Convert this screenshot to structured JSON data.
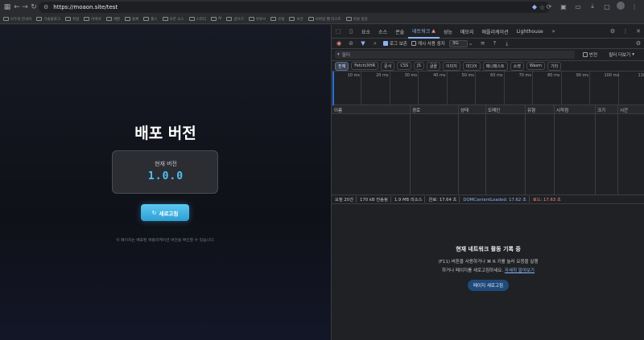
{
  "browser": {
    "url": "https://moaon.site/test",
    "bookmarks": [
      "모두의 한국어",
      "기술블로그",
      "취업",
      "이력서",
      "개발",
      "블록",
      "툴스",
      "오픈 소스",
      "스터디",
      "AI",
      "글쓰기",
      "유튜브",
      "유틸",
      "보안",
      "모바일 웹 리스트",
      "유틸 점검"
    ]
  },
  "page": {
    "title": "배포 버전",
    "version_label": "현재 버전",
    "version_value": "1.0.0",
    "refresh_label": "새로고침",
    "note": "이 페이지는 배포된 애플리케이션 버전을 확인할 수 있습니다."
  },
  "devtools": {
    "tabs": [
      "요소",
      "소스",
      "콘솔",
      "네트워크",
      "성능",
      "메모리",
      "애플리케이션",
      "Lighthouse"
    ],
    "active_tab": "네트워크",
    "toolbar": {
      "preserve_log": "로그 보존",
      "disable_cache": "캐시 사용 중지",
      "throttle": "3G"
    },
    "filter_placeholder": "필터",
    "invert_label": "반전",
    "more_filters": "필터 더보기",
    "types": [
      "전체",
      "Fetch/XHR",
      "문서",
      "CSS",
      "JS",
      "글꼴",
      "이미지",
      "미디어",
      "매니페스트",
      "소켓",
      "Wasm",
      "기타"
    ],
    "timeline_ticks": [
      "10 ms",
      "20 ms",
      "30 ms",
      "40 ms",
      "50 ms",
      "60 ms",
      "70 ms",
      "80 ms",
      "90 ms",
      "100 ms",
      "110"
    ],
    "columns": [
      "이름",
      "경로",
      "상태",
      "도메인",
      "유형",
      "시작점",
      "크기",
      "시간"
    ],
    "status": {
      "requests": "요청 20건",
      "transferred": "170 kB 전송됨",
      "resources": "1.9 MB 리소스",
      "finish": "완료: 17.64 초",
      "dcl": "DOMContentLoaded: 17.62 초",
      "load": "로드: 17.63 초"
    },
    "empty": {
      "title": "현재 네트워크 활동 기록 중",
      "line1": "(F11) 버튼을 사용하거나 ⌘ R 키를 눌러 요청을 실행",
      "line2_prefix": "하거나 페이지를 새로고침하세요.",
      "link": "자세히 알아보기",
      "button": "페이지 새로고침"
    }
  }
}
